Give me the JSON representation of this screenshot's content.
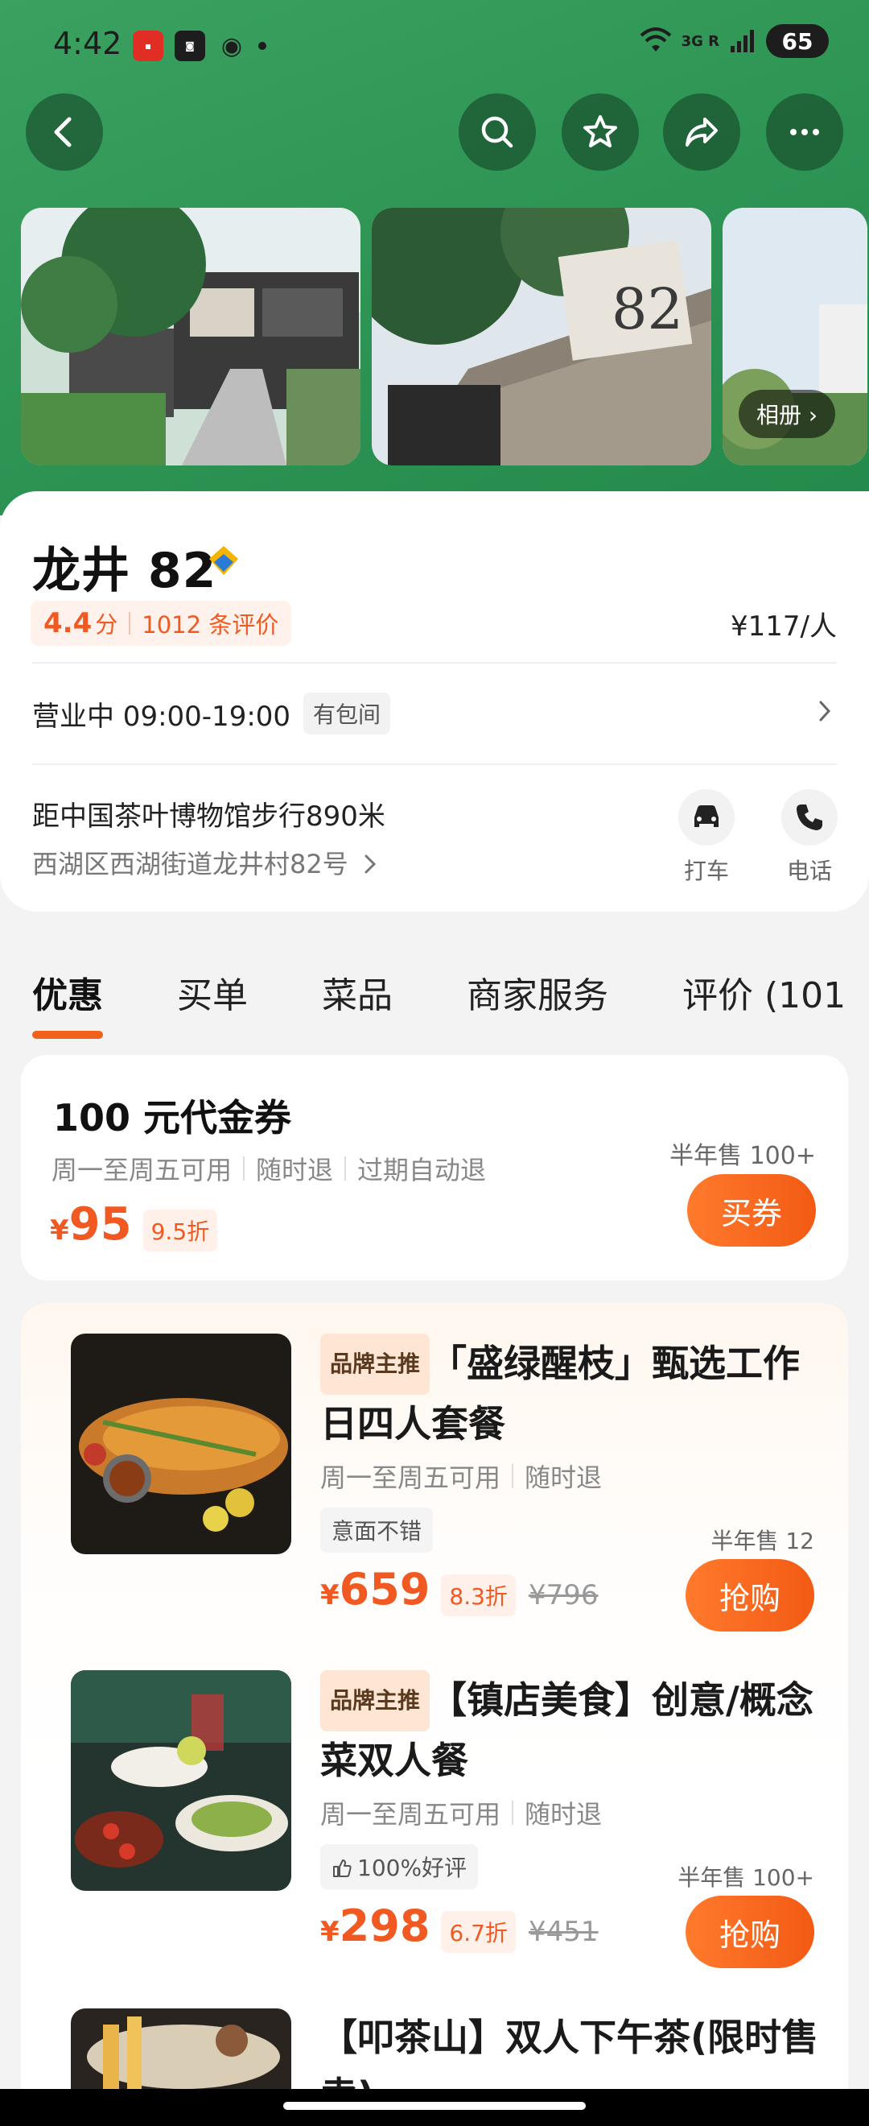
{
  "status_bar": {
    "time": "4:42",
    "network": "3G R",
    "battery": "65"
  },
  "gallery": {
    "album_label": "相册 ›"
  },
  "shop": {
    "name": "龙井 82",
    "score": "4.4",
    "score_unit": "分",
    "reviews": "1012 条评价",
    "price_per_person": "¥117/人",
    "hours": "营业中 09:00-19:00",
    "private_room_tag": "有包间",
    "distance": "距中国茶叶博物馆步行890米",
    "address": "西湖区西湖街道龙井村82号",
    "actions": [
      {
        "label": "打车",
        "icon": "car-icon"
      },
      {
        "label": "电话",
        "icon": "phone-icon"
      }
    ]
  },
  "tabs": [
    "优惠",
    "买单",
    "菜品",
    "商家服务",
    "评价 (101"
  ],
  "voucher": {
    "title": "100 元代金券",
    "conditions": [
      "周一至周五可用",
      "随时退",
      "过期自动退"
    ],
    "yen": "¥",
    "price": "95",
    "discount": "9.5折",
    "sold": "半年售 100+",
    "button": "买券"
  },
  "deals": [
    {
      "brand_tag": "品牌主推",
      "title": "「盛绿醒枝」甄选工作日四人套餐",
      "conditions": [
        "周一至周五可用",
        "随时退"
      ],
      "chip": "意面不错",
      "yen": "¥",
      "price": "659",
      "discount": "8.3折",
      "original": "¥796",
      "sold": "半年售 12",
      "button": "抢购"
    },
    {
      "brand_tag": "品牌主推",
      "title": "【镇店美食】创意/概念菜双人餐",
      "conditions": [
        "周一至周五可用",
        "随时退"
      ],
      "chip": "100%好评",
      "yen": "¥",
      "price": "298",
      "discount": "6.7折",
      "original": "¥451",
      "sold": "半年售 100+",
      "button": "抢购"
    },
    {
      "title": "【叩茶山】双人下午茶(限时售卖)"
    }
  ],
  "colors": {
    "brand_green": "#2f9656",
    "accent_orange": "#f05a22"
  }
}
